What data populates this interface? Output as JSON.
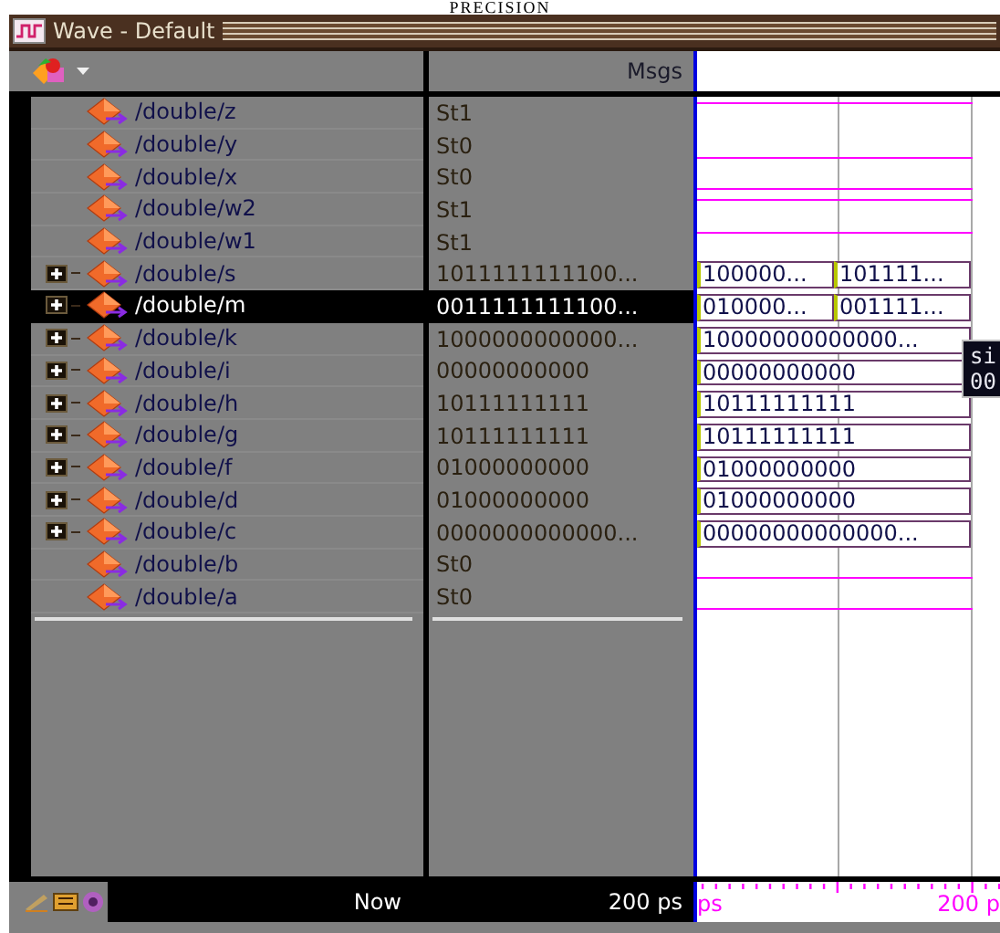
{
  "title_strip": "PRECISION",
  "window": {
    "title": "Wave - Default"
  },
  "header": {
    "values_column": "Msgs"
  },
  "signals": [
    {
      "name": "/double/z",
      "value": "St1",
      "kind": "scalar",
      "high": true,
      "selected": false
    },
    {
      "name": "/double/y",
      "value": "St0",
      "kind": "scalar",
      "high": false,
      "selected": false
    },
    {
      "name": "/double/x",
      "value": "St0",
      "kind": "scalar",
      "high": false,
      "selected": false
    },
    {
      "name": "/double/w2",
      "value": "St1",
      "kind": "scalar",
      "high": true,
      "selected": false
    },
    {
      "name": "/double/w1",
      "value": "St1",
      "kind": "scalar",
      "high": true,
      "selected": false
    },
    {
      "name": "/double/s",
      "value": "1011111111100...",
      "kind": "bus",
      "expanded": false,
      "selected": false,
      "segments": [
        "100000...",
        "101111..."
      ]
    },
    {
      "name": "/double/m",
      "value": "0011111111100...",
      "kind": "bus",
      "expanded": false,
      "selected": true,
      "segments": [
        "010000...",
        "001111..."
      ]
    },
    {
      "name": "/double/k",
      "value": "1000000000000...",
      "kind": "bus",
      "expanded": false,
      "selected": false,
      "segments": [
        "10000000000000..."
      ]
    },
    {
      "name": "/double/i",
      "value": "00000000000",
      "kind": "bus",
      "expanded": false,
      "selected": false,
      "segments": [
        "00000000000"
      ]
    },
    {
      "name": "/double/h",
      "value": "10111111111",
      "kind": "bus",
      "expanded": false,
      "selected": false,
      "segments": [
        "10111111111"
      ]
    },
    {
      "name": "/double/g",
      "value": "10111111111",
      "kind": "bus",
      "expanded": false,
      "selected": false,
      "segments": [
        "10111111111"
      ]
    },
    {
      "name": "/double/f",
      "value": "01000000000",
      "kind": "bus",
      "expanded": false,
      "selected": false,
      "segments": [
        "01000000000"
      ]
    },
    {
      "name": "/double/d",
      "value": "01000000000",
      "kind": "bus",
      "expanded": false,
      "selected": false,
      "segments": [
        "01000000000"
      ]
    },
    {
      "name": "/double/c",
      "value": "0000000000000...",
      "kind": "bus",
      "expanded": false,
      "selected": false,
      "segments": [
        "00000000000000..."
      ]
    },
    {
      "name": "/double/b",
      "value": "St0",
      "kind": "scalar",
      "high": false,
      "selected": false
    },
    {
      "name": "/double/a",
      "value": "St0",
      "kind": "scalar",
      "high": false,
      "selected": false
    }
  ],
  "tooltip": {
    "lines": [
      "si",
      "00"
    ]
  },
  "footer": {
    "now_label": "Now",
    "now_value": "200 ps",
    "ruler_labels": [
      "ps",
      "200 p"
    ]
  }
}
